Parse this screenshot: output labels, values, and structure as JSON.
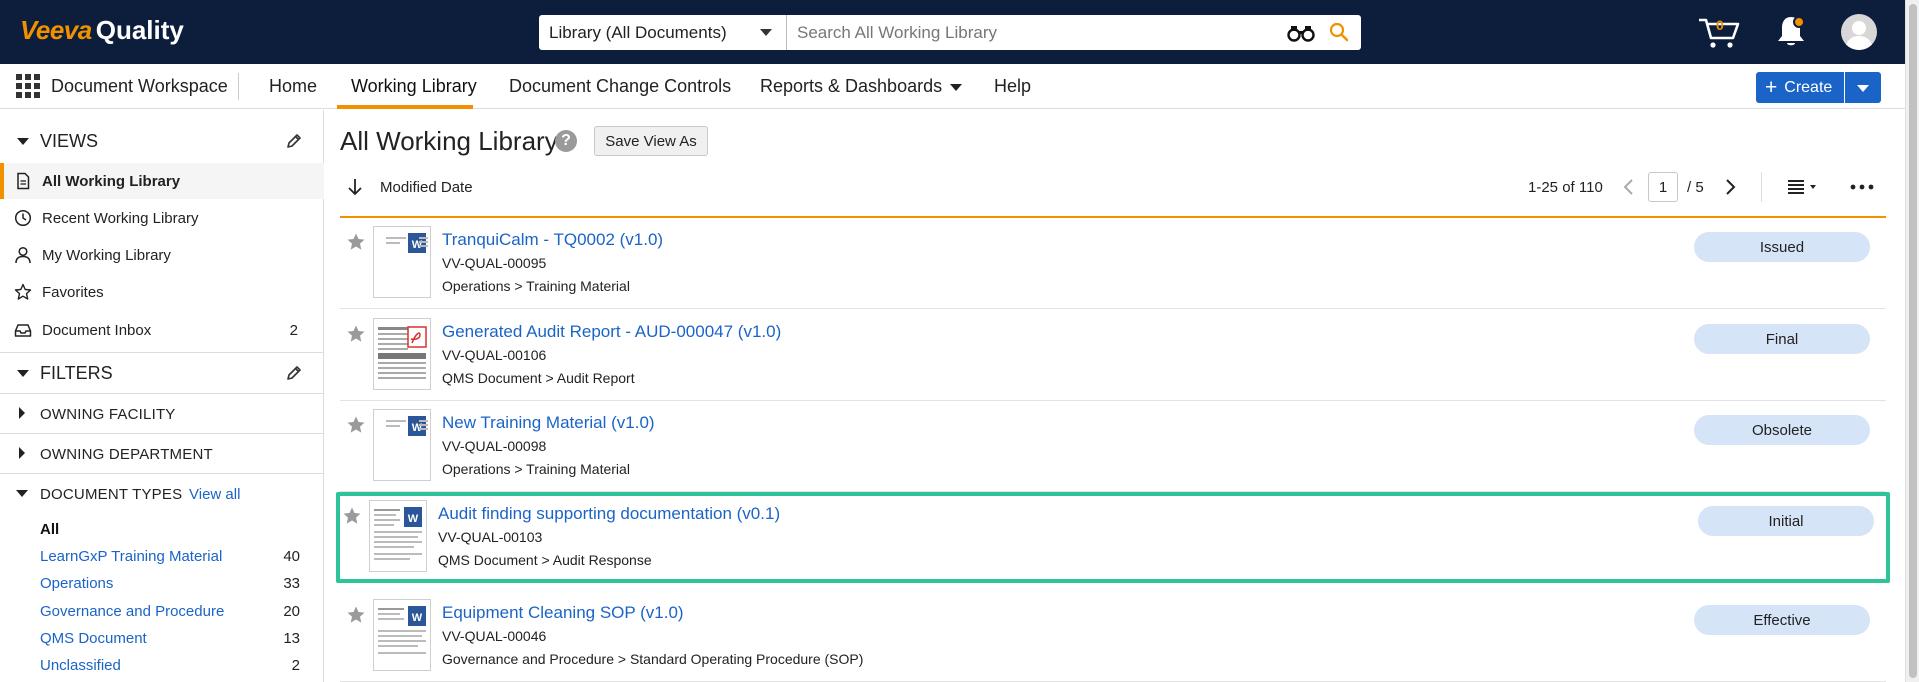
{
  "header": {
    "brand": "Veeva",
    "product": "Quality",
    "search_scope": "Library (All Documents)",
    "search_placeholder": "Search All Working Library",
    "cart_count": "0",
    "colors": {
      "topbar": "#0c1e3c",
      "accent": "#f29100",
      "link": "#1b64c7",
      "selection": "#2fc39a"
    }
  },
  "nav": {
    "workspace": "Document Workspace",
    "items": [
      {
        "label": "Home"
      },
      {
        "label": "Working Library",
        "active": true
      },
      {
        "label": "Document Change Controls"
      },
      {
        "label": "Reports & Dashboards",
        "dropdown": true
      },
      {
        "label": "Help"
      }
    ],
    "create_label": "Create"
  },
  "sidebar": {
    "views_heading": "VIEWS",
    "views": [
      {
        "label": "All Working Library",
        "icon": "document-icon",
        "active": true
      },
      {
        "label": "Recent Working Library",
        "icon": "clock-icon"
      },
      {
        "label": "My Working Library",
        "icon": "user-icon"
      },
      {
        "label": "Favorites",
        "icon": "star-icon"
      },
      {
        "label": "Document Inbox",
        "icon": "inbox-icon",
        "count": "2"
      }
    ],
    "filters_heading": "FILTERS",
    "filters": [
      {
        "label": "OWNING FACILITY"
      },
      {
        "label": "OWNING DEPARTMENT"
      }
    ],
    "doc_types": {
      "label": "DOCUMENT TYPES",
      "view_all": "View all",
      "items": [
        {
          "label": "All",
          "count": ""
        },
        {
          "label": "LearnGxP Training Material",
          "count": "40"
        },
        {
          "label": "Operations",
          "count": "33"
        },
        {
          "label": "Governance and Procedure",
          "count": "20"
        },
        {
          "label": "QMS Document",
          "count": "13"
        },
        {
          "label": "Unclassified",
          "count": "2"
        }
      ]
    }
  },
  "main": {
    "title": "All Working Library",
    "save_view": "Save View As",
    "sort_label": "Modified Date",
    "page_range": "1-25 of 110",
    "page_current": "1",
    "page_of": "/  5",
    "documents": [
      {
        "title": "TranquiCalm - TQ0002 (v1.0)",
        "number": "VV-QUAL-00095",
        "type": "Operations > Training Material",
        "status": "Issued",
        "file": "word"
      },
      {
        "title": "Generated Audit Report - AUD-000047 (v1.0)",
        "number": "VV-QUAL-00106",
        "type": "QMS Document > Audit Report",
        "status": "Final",
        "file": "pdf"
      },
      {
        "title": "New Training Material (v1.0)",
        "number": "VV-QUAL-00098",
        "type": "Operations > Training Material",
        "status": "Obsolete",
        "file": "word"
      },
      {
        "title": "Audit finding supporting documentation (v0.1)",
        "number": "VV-QUAL-00103",
        "type": "QMS Document > Audit Response",
        "status": "Initial",
        "file": "word",
        "selected": true
      },
      {
        "title": "Equipment Cleaning SOP (v1.0)",
        "number": "VV-QUAL-00046",
        "type": "Governance and Procedure > Standard Operating Procedure (SOP)",
        "status": "Effective",
        "file": "word"
      }
    ]
  }
}
